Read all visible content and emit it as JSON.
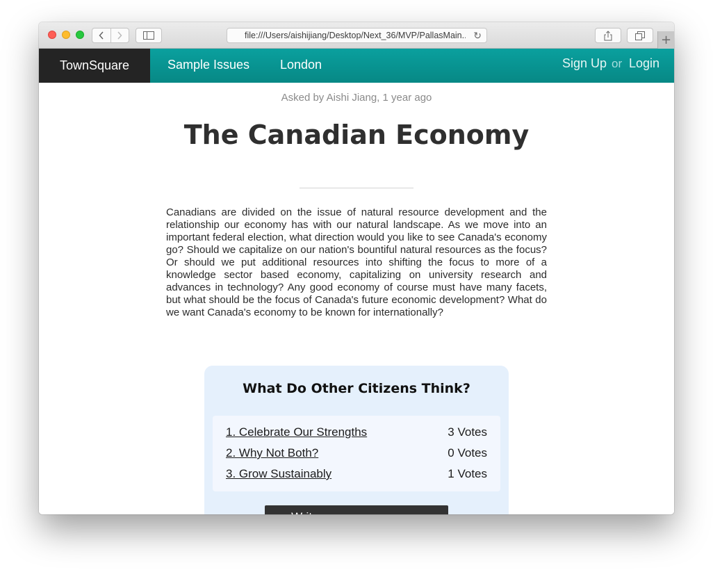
{
  "browser": {
    "url": "file:///Users/aishijiang/Desktop/Next_36/MVP/PallasMain..."
  },
  "nav": {
    "brand": "TownSquare",
    "links": [
      "Sample Issues",
      "London"
    ],
    "sign_up": "Sign Up",
    "or": "or",
    "login": "Login"
  },
  "issue": {
    "asked_by": "Asked by Aishi Jiang, 1 year ago",
    "title": "The Canadian Economy",
    "description": "Canadians are divided on the issue of natural resource development and the relationship our economy has with our natural landscape. As we move into an important federal election, what direction would you like to see Canada's economy go? Should we capitalize on our nation's bountiful natural resources as the focus? Or should we put additional resources into shifting the focus to more of a knowledge sector based economy, capitalizing on university research and advances in technology? Any good economy of course must have many facets, but what should be the focus of Canada's future economic development? What do we want Canada's economy to be known for internationally?"
  },
  "poll": {
    "title": "What Do Other Citizens Think?",
    "options": [
      {
        "label": "1. Celebrate Our Strengths",
        "votes": "3 Votes"
      },
      {
        "label": "2. Why Not Both?",
        "votes": "0 Votes"
      },
      {
        "label": "3. Grow Sustainably",
        "votes": "1 Votes"
      }
    ],
    "button": "Write your own response"
  },
  "colors": {
    "nav_teal": "#079491",
    "brand_bg": "#242424",
    "poll_bg": "#e5f0fc",
    "button_bg": "#333333"
  }
}
